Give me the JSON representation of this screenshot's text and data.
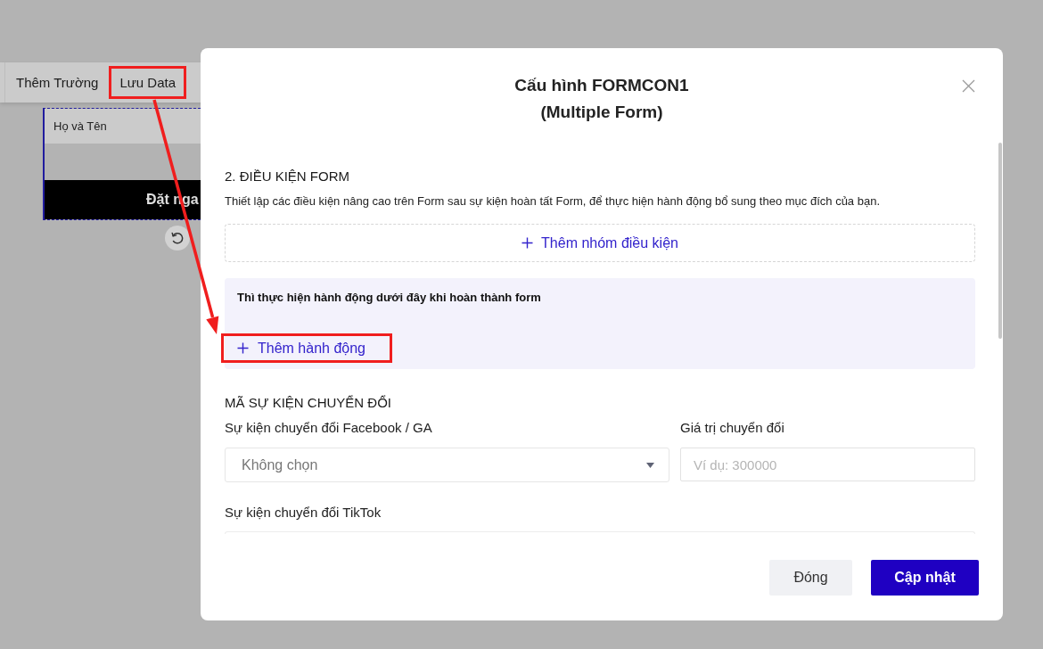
{
  "app_toolbar": {
    "items": [
      {
        "label": "Thêm Trường",
        "highlighted": false
      },
      {
        "label": "Lưu Data",
        "highlighted": true
      }
    ]
  },
  "form_preview": {
    "name_field": {
      "placeholder": "Họ và Tên"
    },
    "submit_button": {
      "label": "Đặt nga"
    }
  },
  "dialog": {
    "title": "Cấu hình FORMCON1",
    "subtitle": "(Multiple Form)",
    "conditions": {
      "heading": "2. ĐIỀU KIỆN FORM",
      "description": "Thiết lập các điều kiện nâng cao trên Form sau sự kiện hoàn tất Form, để thực hiện hành động bổ sung theo mục đích của bạn.",
      "add_group_button": {
        "label": "Thêm nhóm điều kiện"
      },
      "actions_panel": {
        "title": "Thì thực hiện hành động dưới đây khi hoàn thành form",
        "add_action_button": {
          "label": "Thêm hành động",
          "highlighted": true
        }
      }
    },
    "conversion": {
      "heading": "MÃ SỰ KIỆN CHUYỂN ĐỔI",
      "fields": [
        {
          "kind": "select",
          "label": "Sự kiện chuyển đổi Facebook / GA",
          "value": "Không chọn"
        },
        {
          "kind": "input",
          "label": "Giá trị chuyển đổi",
          "placeholder": "Ví dụ: 300000"
        },
        {
          "kind": "clipped",
          "label": "Sự kiện chuyển đổi TikTok"
        }
      ]
    },
    "buttons": [
      {
        "kind": "secondary",
        "label": "Đóng"
      },
      {
        "kind": "primary",
        "label": "Cập nhật"
      }
    ]
  }
}
